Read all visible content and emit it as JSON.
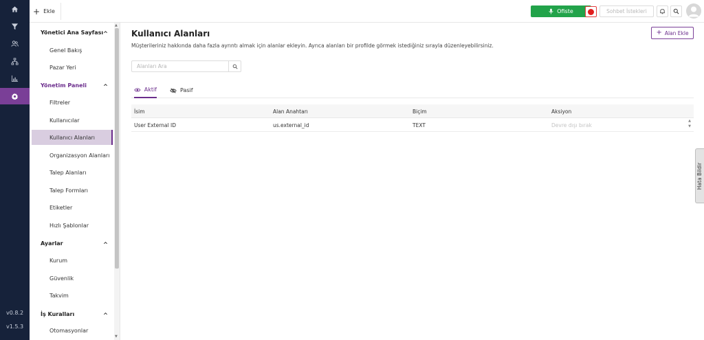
{
  "topbar": {
    "add_label": "Ekle",
    "office_label": "Ofiste",
    "chat_requests_label": "Sohbet İstekleri"
  },
  "rail": {
    "icons": [
      "home-icon",
      "filter-icon",
      "users-icon",
      "sitemap-icon",
      "chart-icon",
      "gear-icon"
    ],
    "versions": [
      "v0.8.2",
      "v1.5.3"
    ]
  },
  "sidebar": {
    "sections": [
      {
        "title": "Yönetici Ana Sayfası",
        "items": [
          "Genel Bakış",
          "Pazar Yeri"
        ]
      },
      {
        "title": "Yönetim Paneli",
        "items": [
          "Filtreler",
          "Kullanıcılar",
          "Kullanıcı Alanları",
          "Organizasyon Alanları",
          "Talep Alanları",
          "Talep Formları",
          "Etiketler",
          "Hızlı Şablonlar"
        ]
      },
      {
        "title": "Ayarlar",
        "items": [
          "Kurum",
          "Güvenlik",
          "Takvim"
        ]
      },
      {
        "title": "İş Kuralları",
        "items": [
          "Otomasyonlar"
        ]
      }
    ],
    "active_item": "Kullanıcı Alanları"
  },
  "main": {
    "title": "Kullanıcı Alanları",
    "description": "Müşterileriniz hakkında daha fazla ayrıntı almak için alanlar ekleyin. Ayrıca alanları bir profilde görmek istediğiniz sırayla düzenleyebilirsiniz.",
    "add_field_label": "Alan Ekle",
    "search_placeholder": "Alanları Ara",
    "tabs": [
      "Aktif",
      "Pasif"
    ],
    "active_tab": "Aktif",
    "table": {
      "columns": [
        "İsim",
        "Alan Anahtarı",
        "Biçim",
        "Aksiyon"
      ],
      "rows": [
        [
          "User External ID",
          "us.external_id",
          "TEXT",
          "Devre dışı bırak"
        ]
      ]
    }
  },
  "bug_report_label": "Hata Bildir",
  "colors": {
    "rail_bg": "#16223a",
    "accent_purple": "#6b2d8c",
    "office_green": "#22a34a",
    "record_red": "#e11d1d"
  }
}
